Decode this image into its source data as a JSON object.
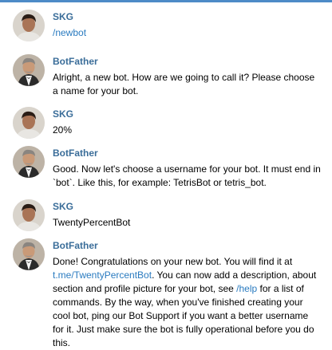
{
  "messages": [
    {
      "sender": "SKG",
      "avatar": "user-avatar",
      "text": "/newbot",
      "text_color": "#2a7bc0"
    },
    {
      "sender": "BotFather",
      "avatar": "botfather-avatar",
      "text": "Alright, a new bot. How are we going to call it? Please choose a name for your bot."
    },
    {
      "sender": "SKG",
      "avatar": "user-avatar",
      "text": "20%"
    },
    {
      "sender": "BotFather",
      "avatar": "botfather-avatar",
      "text": "Good. Now let's choose a username for your bot. It must end in `bot`. Like this, for example: TetrisBot or tetris_bot."
    },
    {
      "sender": "SKG",
      "avatar": "user-avatar",
      "text": "TwentyPercentBot"
    },
    {
      "sender": "BotFather",
      "avatar": "botfather-avatar",
      "parts": {
        "p1": "Done! Congratulations on your new bot. You will find it at ",
        "link1": "t.me/TwentyPercentBot",
        "p2": ". You can now add a description, about section and profile picture for your bot, see ",
        "link2": "/help",
        "p3": " for a list of commands. By the way, when you've finished creating your cool bot, ping our Bot Support if you want a better username for it. Just make sure the bot is fully operational before you do this."
      }
    }
  ],
  "colors": {
    "sender_name": "#3a6d99",
    "link": "#2a7bc0",
    "top_bar": "#4d8bc7"
  }
}
